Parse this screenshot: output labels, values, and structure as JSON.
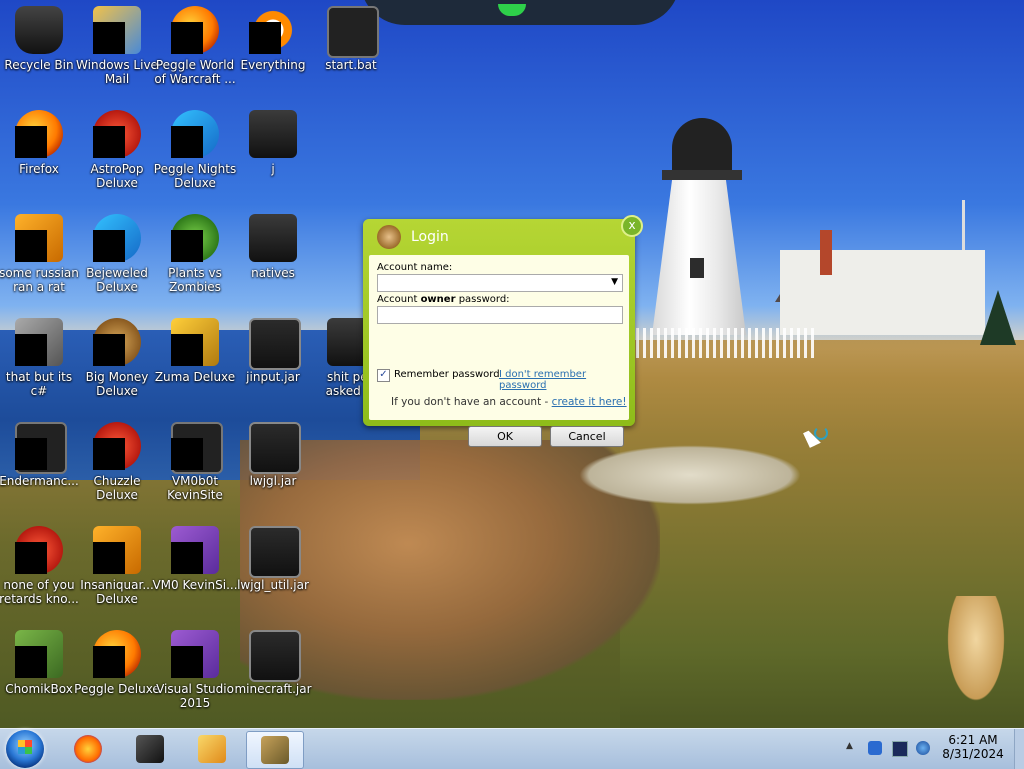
{
  "desktop": {
    "icons": [
      {
        "label": "Recycle Bin",
        "icon": "recycle-bin-icon"
      },
      {
        "label": "Windows Live Mail",
        "icon": "windows-live-mail-icon"
      },
      {
        "label": "Peggle World of Warcraft ...",
        "icon": "peggle-wow-icon"
      },
      {
        "label": "Everything",
        "icon": "everything-search-icon"
      },
      {
        "label": "start.bat",
        "icon": "batch-file-icon"
      },
      {
        "label": "Firefox",
        "icon": "firefox-icon"
      },
      {
        "label": "AstroPop Deluxe",
        "icon": "astropop-icon"
      },
      {
        "label": "Peggle Nights Deluxe",
        "icon": "peggle-nights-icon"
      },
      {
        "label": "j",
        "icon": "folder-icon"
      },
      {
        "label": "some russian ran a rat",
        "icon": "app-icon"
      },
      {
        "label": "Bejeweled Deluxe",
        "icon": "bejeweled-icon"
      },
      {
        "label": "Plants vs Zombies",
        "icon": "plants-vs-zombies-icon"
      },
      {
        "label": "natives",
        "icon": "folder-icon"
      },
      {
        "label": "that but its c#",
        "icon": "app-icon"
      },
      {
        "label": "Big Money Deluxe",
        "icon": "big-money-icon"
      },
      {
        "label": "Zuma Deluxe",
        "icon": "zuma-icon"
      },
      {
        "label": "jinput.jar",
        "icon": "jar-file-icon"
      },
      {
        "label": "shit peo asked m",
        "icon": "folder-icon"
      },
      {
        "label": "Endermanc...",
        "icon": "app-icon"
      },
      {
        "label": "Chuzzle Deluxe",
        "icon": "chuzzle-icon"
      },
      {
        "label": "VM0b0t KevinSite",
        "icon": "app-icon"
      },
      {
        "label": "lwjgl.jar",
        "icon": "jar-file-icon"
      },
      {
        "label": "none of you retards kno...",
        "icon": "app-icon"
      },
      {
        "label": "Insaniquar... Deluxe",
        "icon": "insaniquarium-icon"
      },
      {
        "label": "VM0 KevinSi...",
        "icon": "app-icon"
      },
      {
        "label": "lwjgl_util.jar",
        "icon": "jar-file-icon"
      },
      {
        "label": "ChomikBox",
        "icon": "chomikbox-icon"
      },
      {
        "label": "Peggle Deluxe",
        "icon": "peggle-icon"
      },
      {
        "label": "Visual Studio 2015",
        "icon": "visual-studio-icon"
      },
      {
        "label": "minecraft.jar",
        "icon": "jar-file-icon"
      }
    ]
  },
  "login": {
    "title": "Login",
    "close_glyph": "x",
    "account_label": "Account name:",
    "account_value": "",
    "password_label_pre": "Account ",
    "password_label_bold": "owner",
    "password_label_post": " password:",
    "password_value": "",
    "remember_label": "Remember password",
    "remember_checked": true,
    "forgot_link": "I don't remember password",
    "no_account_text": "If you don't have an account - ",
    "create_link": "create it here!",
    "ok_label": "OK",
    "cancel_label": "Cancel"
  },
  "taskbar": {
    "clock_time": "6:21 AM",
    "clock_date": "8/31/2024",
    "apps": [
      "firefox-icon",
      "console-icon",
      "media-player-icon",
      "chomikbox-icon"
    ],
    "tray_expand_glyph": "▲"
  }
}
